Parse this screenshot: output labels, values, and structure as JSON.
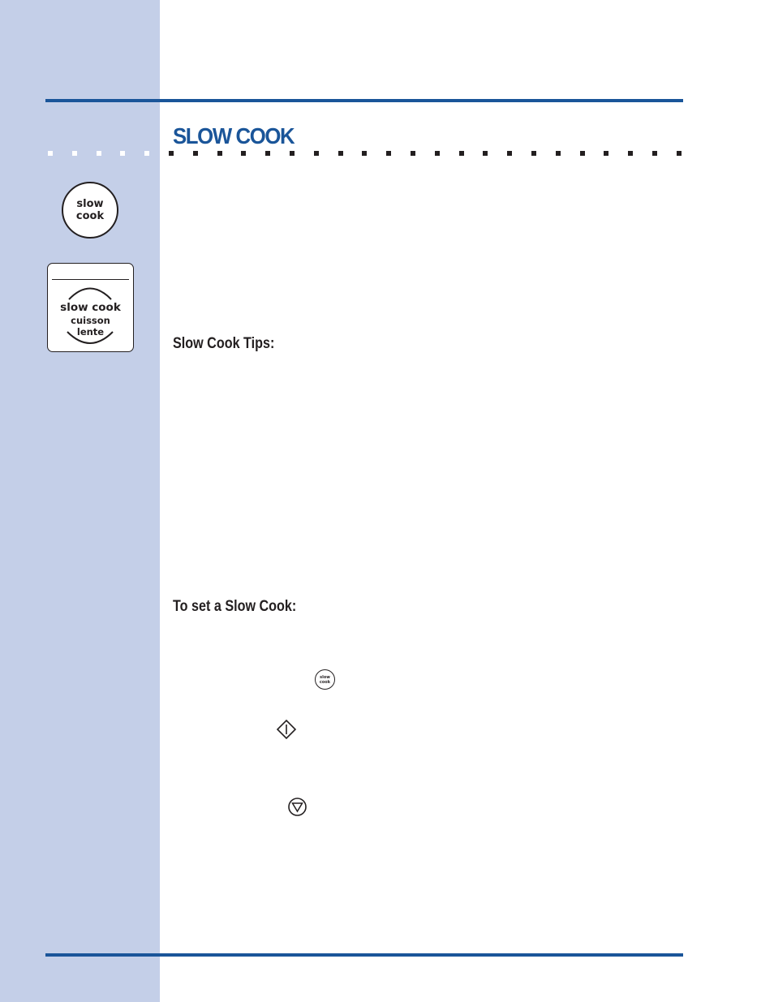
{
  "page": {
    "title": "SLOW COOK",
    "colors": {
      "accent": "#1a5599",
      "sidebar": "#c4cfe8",
      "text": "#231f20"
    }
  },
  "sidebar": {
    "round_button": {
      "icon": "slow-cook-button-icon",
      "line1": "slow",
      "line2": "cook"
    },
    "panel_button": {
      "icon": "slow-cook-panel-icon",
      "line1": "slow cook",
      "line2": "cuisson",
      "line3": "lente"
    }
  },
  "sections": {
    "tips_heading": "Slow Cook Tips:",
    "set_heading": "To set a Slow Cook:"
  },
  "inline_icons": {
    "slow_cook": {
      "icon": "slow-cook-key-icon",
      "line1": "slow",
      "line2": "cook"
    },
    "start": {
      "icon": "start-key-icon"
    },
    "stop": {
      "icon": "stop-key-icon"
    }
  }
}
